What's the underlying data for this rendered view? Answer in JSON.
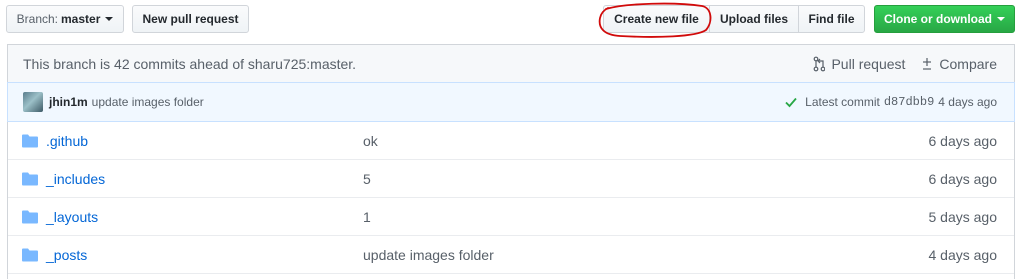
{
  "toolbar": {
    "branch_prefix": "Branch:",
    "branch_name": "master",
    "new_pull_request": "New pull request",
    "create_new_file": "Create new file",
    "upload_files": "Upload files",
    "find_file": "Find file",
    "clone_or_download": "Clone or download"
  },
  "ahead_bar": {
    "text": "This branch is 42 commits ahead of sharu725:master.",
    "pull_request": "Pull request",
    "compare": "Compare"
  },
  "latest_commit": {
    "author": "jhin1m",
    "message": "update images folder",
    "label": "Latest commit",
    "sha": "d87dbb9",
    "age": "4 days ago"
  },
  "files": [
    {
      "name": ".github",
      "message": "ok",
      "age": "6 days ago"
    },
    {
      "name": "_includes",
      "message": "5",
      "age": "6 days ago"
    },
    {
      "name": "_layouts",
      "message": "1",
      "age": "5 days ago"
    },
    {
      "name": "_posts",
      "message": "update images folder",
      "age": "4 days ago"
    }
  ],
  "colors": {
    "link": "#0366d6",
    "clone_button": "#28a745",
    "annotation_circle": "#d10a0a",
    "folder_icon": "#79b8ff"
  },
  "icons": {
    "branch_caret": "chevron-down-icon",
    "pull_request": "git-pull-request-icon",
    "compare": "diff-icon",
    "commit_status": "check-icon",
    "file_rows": "folder-icon"
  }
}
